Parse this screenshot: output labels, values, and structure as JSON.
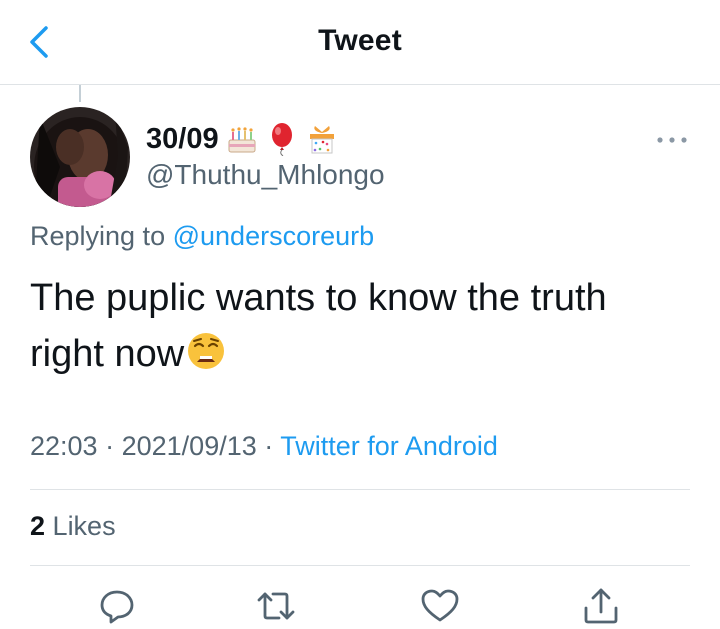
{
  "header": {
    "title": "Tweet",
    "back_icon": "chevron-left-icon"
  },
  "tweet": {
    "display_name": "30/09",
    "name_emojis": [
      "birthday-cake-emoji",
      "balloon-emoji",
      "wrapped-gift-emoji"
    ],
    "username": "@Thuthu_Mhlongo",
    "replying_prefix": "Replying to",
    "replying_to": "@underscoreurb",
    "text": "The puplic wants to know the truth right now",
    "text_emoji": "weary-face-emoji",
    "time": "22:03",
    "date": "2021/09/13",
    "separator": "·",
    "source": "Twitter for Android"
  },
  "engagement": {
    "likes_count": "2",
    "likes_label": "Likes"
  },
  "actions": [
    "reply-icon",
    "retweet-icon",
    "like-icon",
    "share-icon"
  ],
  "colors": {
    "accent": "#1d9bf0",
    "secondary_text": "#536471",
    "divider": "#dfe3e6"
  }
}
